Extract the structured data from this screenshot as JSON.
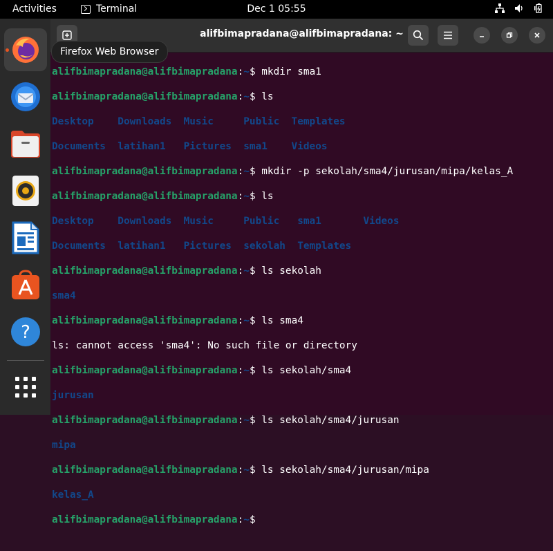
{
  "topbar": {
    "activities": "Activities",
    "app_name": "Terminal",
    "clock": "Dec 1  05:55"
  },
  "dock": {
    "tooltip": "Firefox Web Browser",
    "items": [
      "firefox-icon",
      "thunderbird-icon",
      "files-icon",
      "rhythmbox-icon",
      "writer-icon",
      "app-center-icon",
      "help-icon",
      "show-apps-icon"
    ]
  },
  "window": {
    "title": "alifbimapradana@alifbimapradana: ~"
  },
  "terminal": {
    "user": "alifbimapradana@alifbimapradana",
    "sep": ":",
    "path": "~",
    "prompt": "$ ",
    "cmd1": "mkdir sma1",
    "cmd2": "ls",
    "ls1_row1": "Desktop    Downloads  Music     Public  Templates",
    "ls1_row2": "Documents  latihan1   Pictures  sma1    Videos",
    "cmd3": "mkdir -p sekolah/sma4/jurusan/mipa/kelas_A",
    "cmd4": "ls",
    "ls2_row1": "Desktop    Downloads  Music     Public   sma1       Videos",
    "ls2_row2": "Documents  latihan1   Pictures  sekolah  Templates",
    "cmd5": "ls sekolah",
    "out5": "sma4",
    "cmd6": "ls sma4",
    "out6": "ls: cannot access 'sma4': No such file or directory",
    "cmd7": "ls sekolah/sma4",
    "out7": "jurusan",
    "cmd8": "ls sekolah/sma4/jurusan",
    "out8": "mipa",
    "cmd9": "ls sekolah/sma4/jurusan/mipa",
    "out9": "kelas_A"
  }
}
